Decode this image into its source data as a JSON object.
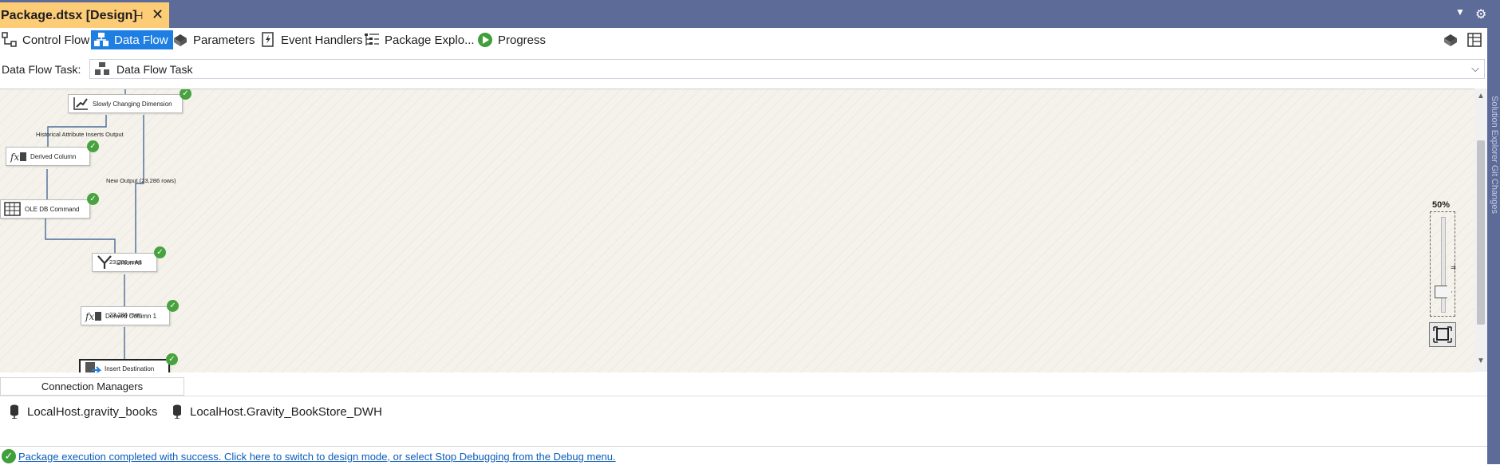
{
  "document_tab": {
    "title": "Package.dtsx [Design]"
  },
  "designer_tabs": [
    {
      "label": "Control Flow",
      "active": false,
      "icon": "control-flow-icon"
    },
    {
      "label": "Data Flow",
      "active": true,
      "icon": "data-flow-icon"
    },
    {
      "label": "Parameters",
      "active": false,
      "icon": "parameters-icon"
    },
    {
      "label": "Event Handlers",
      "active": false,
      "icon": "event-handlers-icon"
    },
    {
      "label": "Package Explo...",
      "active": false,
      "icon": "package-explorer-icon"
    },
    {
      "label": "Progress",
      "active": false,
      "icon": "progress-icon"
    }
  ],
  "task_row": {
    "label": "Data Flow Task:",
    "selected": "Data Flow Task"
  },
  "canvas": {
    "nodes": [
      {
        "name": "Slowly Changing Dimension",
        "status": "success"
      },
      {
        "name": "Derived Column",
        "status": "success"
      },
      {
        "name": "OLE DB Command",
        "status": "success"
      },
      {
        "name": "Union All",
        "status": "success"
      },
      {
        "name": "Derived Column 1",
        "status": "success"
      },
      {
        "name": "Insert Destination",
        "status": "success"
      }
    ],
    "path_labels": {
      "historical": "Historical Attribute Inserts Output",
      "new_output": "New Output (23,286 rows)",
      "rows1": "23,286 rows",
      "rows2": "23,286 rows"
    },
    "zoom": "50%",
    "zoom_level": 0.5
  },
  "connection_managers": {
    "tab_label": "Connection Managers",
    "items": [
      "LocalHost.gravity_books",
      "LocalHost.Gravity_BookStore_DWH"
    ]
  },
  "status": {
    "message": "Package execution completed with success. Click here to switch to design mode, or select Stop Debugging from the Debug menu."
  },
  "side_panel": {
    "label": "Solution Explorer  Git Changes"
  },
  "colors": {
    "accent": "#1f7ee2",
    "doc_tab": "#fccc77",
    "chrome": "#5d6b99",
    "success": "#48a23f",
    "link": "#0c5bb9"
  }
}
